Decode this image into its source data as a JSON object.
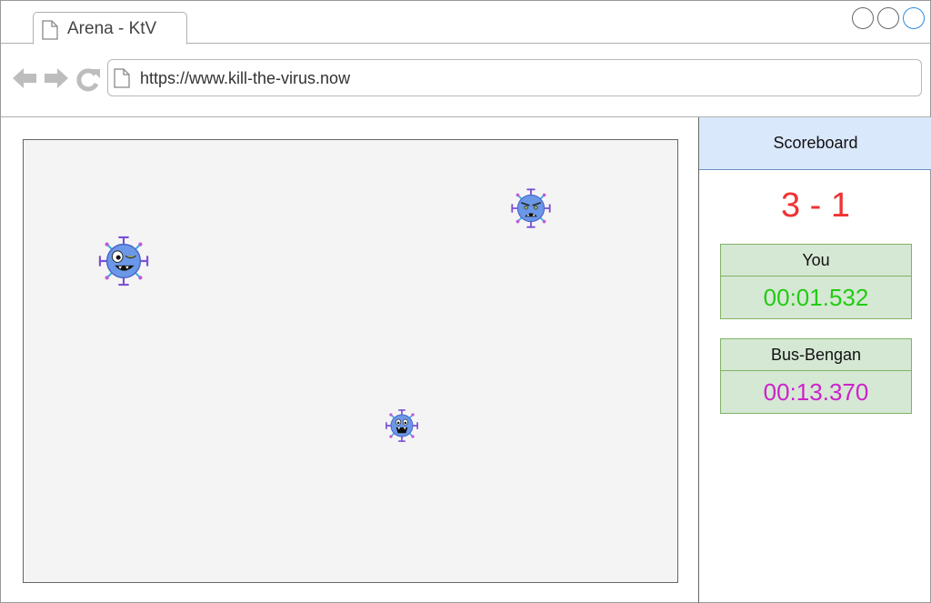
{
  "tab": {
    "title": "Arena - KtV"
  },
  "address_bar": {
    "url": "https://www.kill-the-virus.now"
  },
  "arena": {
    "viruses": [
      {
        "name": "virus-winking"
      },
      {
        "name": "virus-frowning"
      },
      {
        "name": "virus-screaming"
      }
    ]
  },
  "scoreboard": {
    "title": "Scoreboard",
    "score": "3 - 1",
    "players": [
      {
        "name": "You",
        "time": "00:01.532",
        "color": "#22cc11"
      },
      {
        "name": "Bus-Bengan",
        "time": "00:13.370",
        "color": "#cc22cc"
      }
    ]
  },
  "colors": {
    "score": "#ee3333",
    "scoreboard_header": "#dae8fc",
    "player_card": "#d5e8d4",
    "virus_body": "#6b97e8"
  }
}
